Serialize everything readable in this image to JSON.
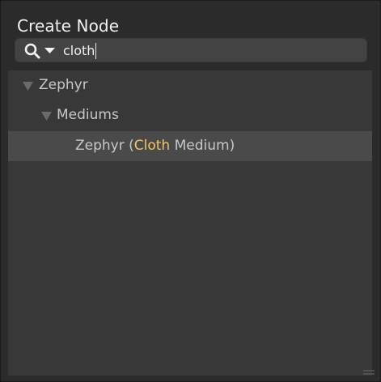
{
  "dialog": {
    "title": "Create Node"
  },
  "search": {
    "query": "cloth",
    "icon": "search-icon",
    "dropdown_icon": "chevron-down-icon"
  },
  "tree": {
    "items": [
      {
        "label": "Zephyr",
        "expanded": true
      },
      {
        "label": "Mediums",
        "expanded": true
      },
      {
        "label_before": "Zephyr (",
        "label_match": "Cloth",
        "label_after": " Medium)",
        "selected": true
      }
    ]
  },
  "colors": {
    "background": "#2b2b2b",
    "tree_background": "#383838",
    "selected_row": "#4a4a4a",
    "match_highlight": "#f3c562",
    "search_field": "#434343"
  }
}
